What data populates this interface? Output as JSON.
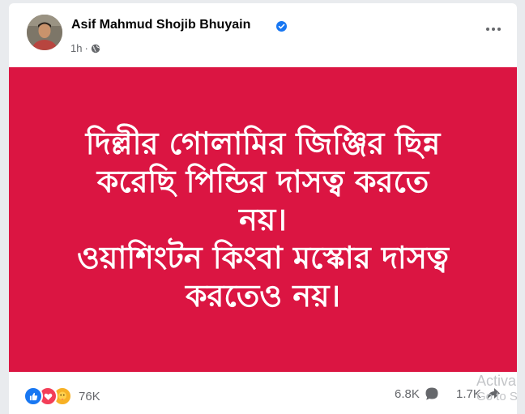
{
  "post": {
    "author": "Asif Mahmud Shojib Bhuyain",
    "time": "1h",
    "separator": "·",
    "text_lines": [
      "দিল্লীর গোলামির জিঞ্জির ছিন্ন",
      "করেছি পিন্ডির দাসত্ব করতে",
      "নয়।",
      "ওয়াশিংটন কিংবা মস্কোর দাসত্ব",
      "করতেও নয়।"
    ]
  },
  "footer": {
    "reactions_count": "76K",
    "comments_count": "6.8K",
    "shares_count": "1.7K"
  },
  "watermark": {
    "line1": "Activa",
    "line2": "Go to S"
  },
  "icons": {
    "audience": "public-globe-icon",
    "verified": "verified-badge-icon",
    "reactions": [
      "like-icon",
      "love-icon",
      "care-icon"
    ],
    "comment": "comment-icon",
    "share": "share-icon",
    "more": "more-options-icon"
  },
  "colors": {
    "banner": "#db1542",
    "like": "#1877f2",
    "love": "#f33e58",
    "care": "#f7b125",
    "verified": "#1877f2"
  }
}
